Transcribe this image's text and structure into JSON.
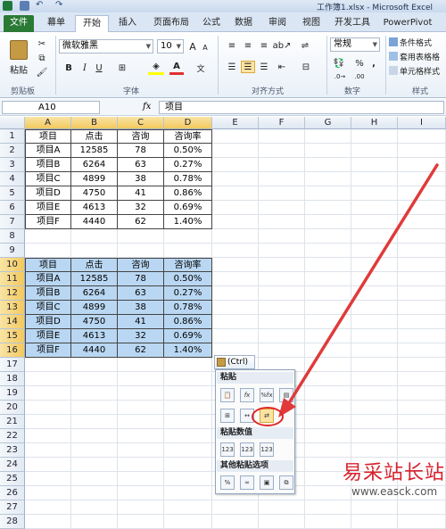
{
  "window": {
    "title": "工作簿1.xlsx - Microsoft Excel"
  },
  "ribbon_tabs": [
    "文件",
    "幕单",
    "开始",
    "插入",
    "页面布局",
    "公式",
    "数据",
    "审阅",
    "视图",
    "开发工具",
    "PowerPivot"
  ],
  "ribbon": {
    "paste_label": "粘贴",
    "font_name": "微软雅黑",
    "font_size": "10",
    "bold": "B",
    "italic": "I",
    "underline": "U",
    "number_format": "常规",
    "percent": "%",
    "comma": ",",
    "conditional_format": "条件格式",
    "table_format": "套用表格格",
    "cell_style": "单元格样式",
    "groups": {
      "clipboard": "剪贴板",
      "font": "字体",
      "alignment": "对齐方式",
      "number": "数字",
      "styles": "样式"
    }
  },
  "formula_bar": {
    "name_box": "A10",
    "fx": "fx",
    "value": "项目"
  },
  "columns": [
    "A",
    "B",
    "C",
    "D",
    "E",
    "F",
    "G",
    "H",
    "I"
  ],
  "rows": [
    "1",
    "2",
    "3",
    "4",
    "5",
    "6",
    "7",
    "8",
    "9",
    "10",
    "11",
    "12",
    "13",
    "14",
    "15",
    "16",
    "17",
    "18",
    "19",
    "20",
    "21",
    "22",
    "23",
    "24",
    "25",
    "26",
    "27",
    "28"
  ],
  "table1": {
    "headers": [
      "项目",
      "点击",
      "咨询",
      "咨询率"
    ],
    "rows": [
      [
        "项目A",
        "12585",
        "78",
        "0.50%"
      ],
      [
        "项目B",
        "6264",
        "63",
        "0.27%"
      ],
      [
        "项目C",
        "4899",
        "38",
        "0.78%"
      ],
      [
        "项目D",
        "4750",
        "41",
        "0.86%"
      ],
      [
        "项目E",
        "4613",
        "32",
        "0.69%"
      ],
      [
        "项目F",
        "4440",
        "62",
        "1.40%"
      ]
    ]
  },
  "table2": {
    "headers": [
      "项目",
      "点击",
      "咨询",
      "咨询率"
    ],
    "rows": [
      [
        "项目A",
        "12585",
        "78",
        "0.50%"
      ],
      [
        "项目B",
        "6264",
        "63",
        "0.27%"
      ],
      [
        "项目C",
        "4899",
        "38",
        "0.78%"
      ],
      [
        "项目D",
        "4750",
        "41",
        "0.86%"
      ],
      [
        "项目E",
        "4613",
        "32",
        "0.69%"
      ],
      [
        "项目F",
        "4440",
        "62",
        "1.40%"
      ]
    ]
  },
  "paste_options": {
    "button_label": "(Ctrl) ▾",
    "section_paste": "粘贴",
    "section_values": "粘贴数值",
    "section_other": "其他粘贴选项",
    "icons_paste": [
      "paste-icon",
      "formulas-icon",
      "formulas-number-format-icon",
      "keep-source-formatting-icon",
      "no-borders-icon",
      "keep-column-widths-icon",
      "transpose-icon"
    ],
    "icons_values": [
      "values-icon",
      "values-number-format-icon",
      "values-source-formatting-icon"
    ],
    "icons_other": [
      "formatting-icon",
      "paste-link-icon",
      "picture-icon",
      "linked-picture-icon"
    ]
  },
  "watermark": {
    "text": "易采站长站",
    "url": "www.easck.com"
  },
  "colors": {
    "accent": "#2a7a36",
    "selection": "#b9d7f2",
    "arrow": "#e03a3a",
    "highlight_circle": "#e02828"
  }
}
